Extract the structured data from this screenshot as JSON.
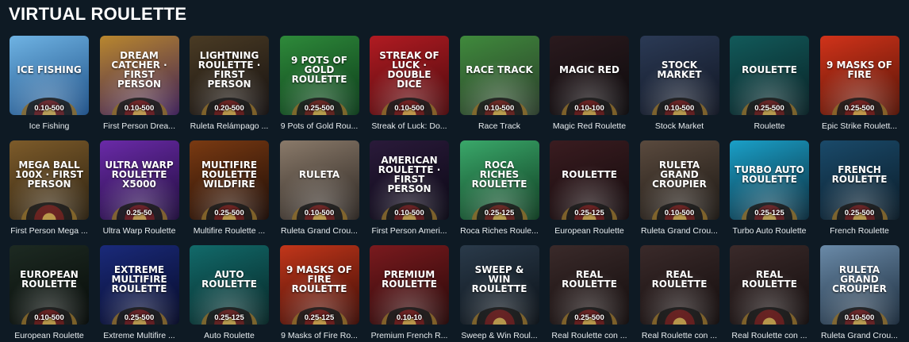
{
  "section_title": "VIRTUAL ROULETTE",
  "games": [
    {
      "name": "Ice Fishing",
      "bet": "0.10-500",
      "art": "ICE FISHING",
      "icon": "ice-fishing-thumbnail",
      "c1": "#6fb3e3",
      "c2": "#1d4f86"
    },
    {
      "name": "First Person Drea...",
      "bet": "0.10-500",
      "art": "DREAM CATCHER · FIRST PERSON",
      "icon": "dream-catcher-thumbnail",
      "c1": "#b9872e",
      "c2": "#3b1e56"
    },
    {
      "name": "Ruleta Relámpago ...",
      "bet": "0.20-500",
      "art": "LIGHTNING ROULETTE · FIRST PERSON",
      "icon": "lightning-roulette-thumbnail",
      "c1": "#4a3b24",
      "c2": "#141010"
    },
    {
      "name": "9 Pots of Gold Rou...",
      "bet": "0.25-500",
      "art": "9 POTS OF GOLD ROULETTE",
      "icon": "pots-of-gold-thumbnail",
      "c1": "#2e8a3a",
      "c2": "#0c3a1a"
    },
    {
      "name": "Streak of Luck: Do...",
      "bet": "0.10-500",
      "art": "STREAK OF LUCK · DOUBLE DICE",
      "icon": "streak-of-luck-thumbnail",
      "c1": "#b11b22",
      "c2": "#4a0a0d"
    },
    {
      "name": "Race Track",
      "bet": "0.10-500",
      "art": "RACE TRACK",
      "icon": "race-track-thumbnail",
      "c1": "#3f8a3c",
      "c2": "#2a3b2a"
    },
    {
      "name": "Magic Red Roulette",
      "bet": "0.10-100",
      "art": "MAGIC RED",
      "icon": "magic-red-thumbnail",
      "c1": "#2a1a1e",
      "c2": "#0c0a0c"
    },
    {
      "name": "Stock Market",
      "bet": "0.10-500",
      "art": "STOCK MARKET",
      "icon": "stock-market-thumbnail",
      "c1": "#2b3a55",
      "c2": "#101522"
    },
    {
      "name": "Roulette",
      "bet": "0.25-500",
      "art": "ROULETTE",
      "icon": "roulette-thumbnail",
      "c1": "#125a5a",
      "c2": "#082024"
    },
    {
      "name": "Epic Strike Roulett...",
      "bet": "0.25-500",
      "art": "9 MASKS OF FIRE",
      "icon": "epic-strike-thumbnail",
      "c1": "#d1331a",
      "c2": "#521306"
    },
    {
      "name": "First Person Mega ...",
      "bet": "",
      "art": "MEGA BALL 100x · FIRST PERSON",
      "icon": "mega-ball-thumbnail",
      "c1": "#7d5b2a",
      "c2": "#2a2010"
    },
    {
      "name": "Ultra Warp Roulette",
      "bet": "0.25-50",
      "art": "ULTRA WARP ROULETTE X5000",
      "icon": "ultra-warp-thumbnail",
      "c1": "#6a2aa8",
      "c2": "#1e0c3a"
    },
    {
      "name": "Multifire Roulette ...",
      "bet": "0.25-500",
      "art": "MULTIFIRE ROULETTE WILDFIRE",
      "icon": "multifire-thumbnail",
      "c1": "#7a3a12",
      "c2": "#1a0b06"
    },
    {
      "name": "Ruleta Grand Crou...",
      "bet": "0.10-500",
      "art": "RULETA",
      "icon": "ruleta-grand-croupier-thumbnail",
      "c1": "#8a7a6a",
      "c2": "#2a2420"
    },
    {
      "name": "First Person Ameri...",
      "bet": "0.10-500",
      "art": "AMERICAN ROULETTE · FIRST PERSON",
      "icon": "american-roulette-thumbnail",
      "c1": "#2a1a3a",
      "c2": "#0a0814"
    },
    {
      "name": "Roca Riches Roule...",
      "bet": "0.25-125",
      "art": "ROCA RICHES ROULETTE",
      "icon": "roca-riches-thumbnail",
      "c1": "#3aa86a",
      "c2": "#0e3a20"
    },
    {
      "name": "European Roulette",
      "bet": "0.25-125",
      "art": "ROULETTE",
      "icon": "european-roulette-thumbnail",
      "c1": "#3a1c20",
      "c2": "#120a0c"
    },
    {
      "name": "Ruleta Grand Crou...",
      "bet": "0.10-500",
      "art": "RULETA GRAND CROUPIER",
      "icon": "ruleta-grand-croupier-2-thumbnail",
      "c1": "#5a4a3e",
      "c2": "#1a1612"
    },
    {
      "name": "Turbo Auto Roulette",
      "bet": "0.25-125",
      "art": "TURBO AUTO ROULETTE",
      "icon": "turbo-auto-thumbnail",
      "c1": "#1aa0c8",
      "c2": "#0a2a3a"
    },
    {
      "name": "French Roulette",
      "bet": "0.25-500",
      "art": "FRENCH ROULETTE",
      "icon": "french-roulette-thumbnail",
      "c1": "#1a4a6a",
      "c2": "#0a1a26"
    },
    {
      "name": "European Roulette",
      "bet": "0.10-500",
      "art": "EUROPEAN ROULETTE",
      "icon": "european-roulette-2-thumbnail",
      "c1": "#1d2a22",
      "c2": "#060a08"
    },
    {
      "name": "Extreme Multifire ...",
      "bet": "0.25-500",
      "art": "EXTREME MULTIFIRE ROULETTE",
      "icon": "extreme-multifire-thumbnail",
      "c1": "#1a2a7a",
      "c2": "#060a26"
    },
    {
      "name": "Auto Roulette",
      "bet": "0.25-125",
      "art": "AUTO ROULETTE",
      "icon": "auto-roulette-thumbnail",
      "c1": "#126a6a",
      "c2": "#062424"
    },
    {
      "name": "9 Masks of Fire Ro...",
      "bet": "0.25-125",
      "art": "9 MASKS OF FIRE ROULETTE",
      "icon": "masks-of-fire-thumbnail",
      "c1": "#c2361a",
      "c2": "#3a0c06"
    },
    {
      "name": "Premium French R...",
      "bet": "0.10-10",
      "art": "PREMIUM ROULETTE",
      "icon": "premium-french-thumbnail",
      "c1": "#7a1a1e",
      "c2": "#240808"
    },
    {
      "name": "Sweep & Win Roul...",
      "bet": "",
      "art": "SWEEP & WIN ROULETTE",
      "icon": "sweep-win-thumbnail",
      "c1": "#2a3a4a",
      "c2": "#0a1016"
    },
    {
      "name": "Real Roulette con ...",
      "bet": "0.25-500",
      "art": "REAL ROULETTE",
      "icon": "real-roulette-1-thumbnail",
      "c1": "#3a2a2a",
      "c2": "#120c0c"
    },
    {
      "name": "Real Roulette con ...",
      "bet": "",
      "art": "REAL ROULETTE",
      "icon": "real-roulette-2-thumbnail",
      "c1": "#3a2a2a",
      "c2": "#120c0c"
    },
    {
      "name": "Real Roulette con ...",
      "bet": "",
      "art": "REAL ROULETTE",
      "icon": "real-roulette-3-thumbnail",
      "c1": "#3a2a2a",
      "c2": "#120c0c"
    },
    {
      "name": "Ruleta Grand Crou...",
      "bet": "0.10-500",
      "art": "RULETA GRAND CROUPIER",
      "icon": "ruleta-grand-croupier-3-thumbnail",
      "c1": "#6a8aa8",
      "c2": "#1a2a3a"
    }
  ]
}
